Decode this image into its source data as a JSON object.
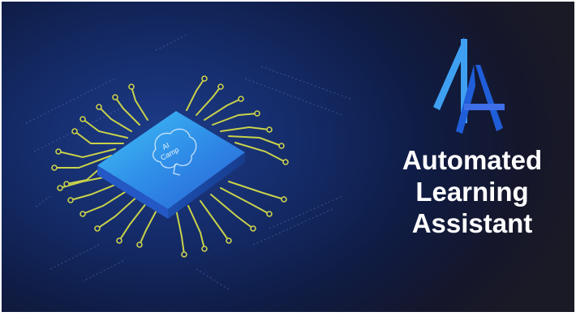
{
  "banner": {
    "chip_label_line1": "AI",
    "chip_label_line2": "Camp",
    "logo_alt": "AA logo",
    "title_line1": "Automated",
    "title_line2": "Learning",
    "title_line3": "Assistant"
  },
  "colors": {
    "background_center": "#1d3c8a",
    "background_edge": "#1a1a26",
    "trace": "#c9d24a",
    "chip_top": "#3aa8f0",
    "logo_light": "#3fa0f2",
    "logo_dark": "#1f5ed8",
    "text": "#ffffff"
  },
  "icons": [
    "circuit-traces-icon",
    "chip-icon",
    "brain-icon",
    "aa-logo-icon"
  ]
}
